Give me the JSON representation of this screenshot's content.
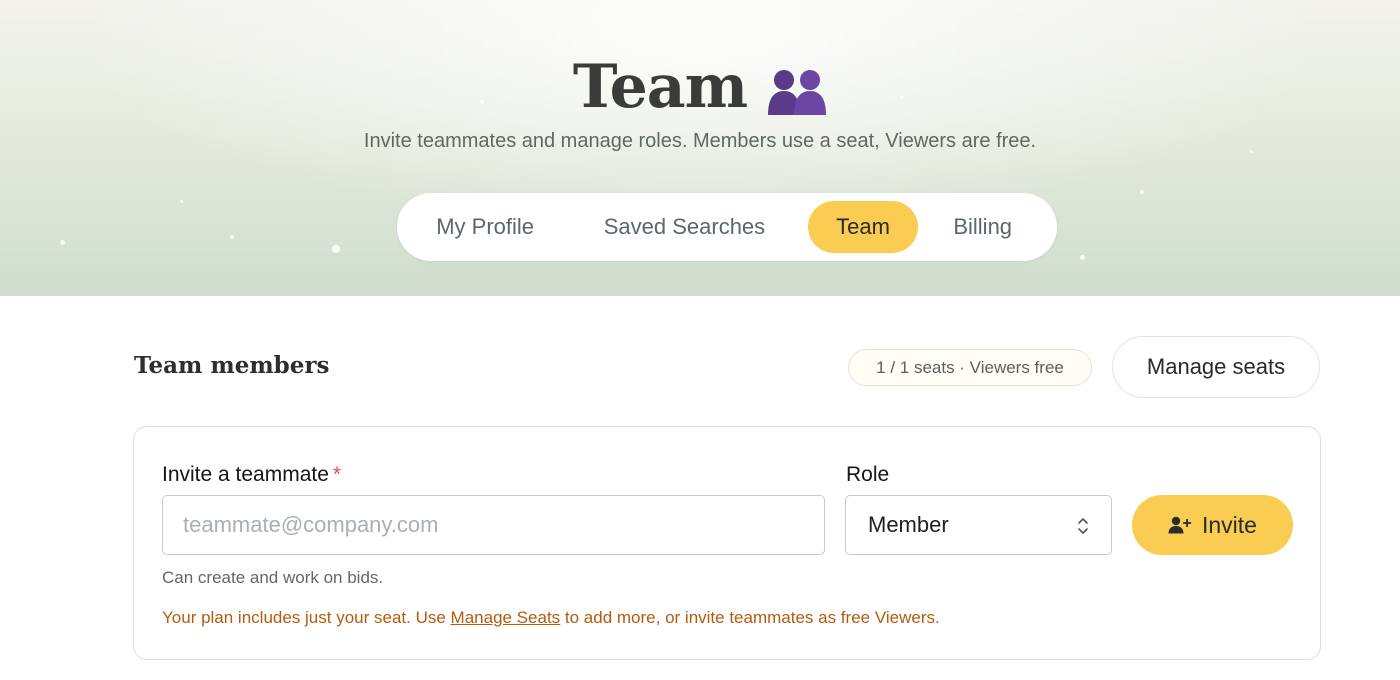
{
  "hero": {
    "title": "Team",
    "title_icon": "people-icon",
    "subtitle": "Invite teammates and manage roles. Members use a seat, Viewers are free.",
    "tabs": [
      {
        "label": "My Profile",
        "active": false
      },
      {
        "label": "Saved Searches",
        "active": false
      },
      {
        "label": "Team",
        "active": true
      },
      {
        "label": "Billing",
        "active": false
      }
    ]
  },
  "members": {
    "title": "Team members",
    "seats_badge": "1 / 1 seats · Viewers free",
    "manage_seats_label": "Manage seats"
  },
  "invite": {
    "label": "Invite a teammate",
    "required_mark": "*",
    "email_placeholder": "teammate@company.com",
    "email_value": "",
    "role_label": "Role",
    "role_value": "Member",
    "invite_button_label": "Invite",
    "role_help": "Can create and work on bids.",
    "plan_note_before": "Your plan includes just your seat. Use ",
    "plan_note_link": "Manage Seats",
    "plan_note_after": " to add more, or invite teammates as free Viewers."
  },
  "colors": {
    "accent": "#fbcc52",
    "required": "#e44b4b",
    "warning_text": "#b55a0f",
    "icon_purple": "#5b3a8c"
  }
}
